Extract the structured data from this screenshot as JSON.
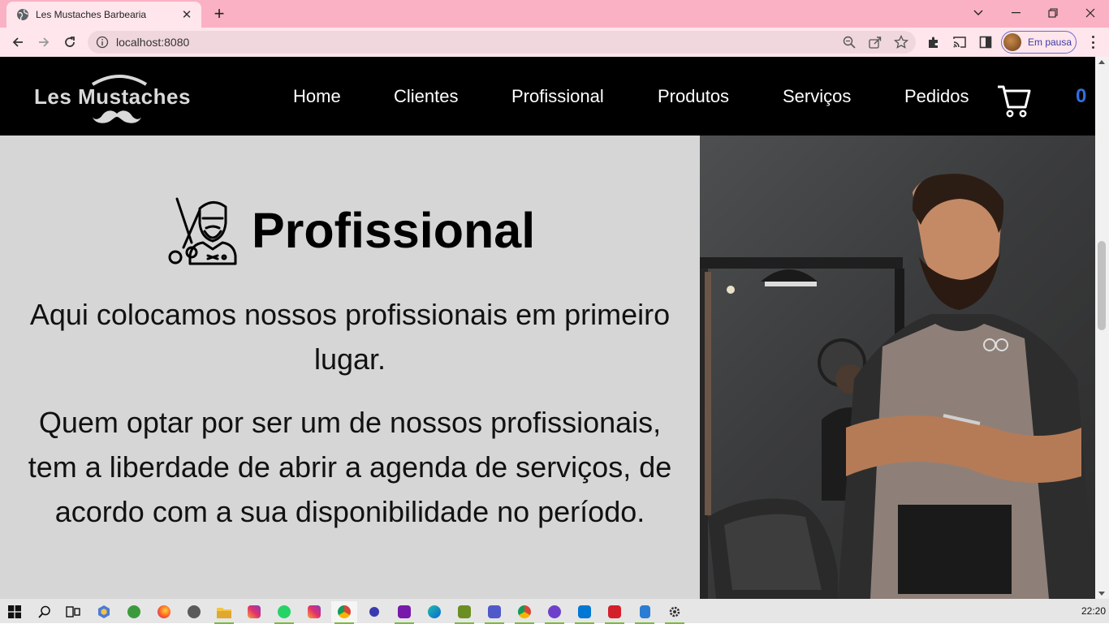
{
  "browser": {
    "tab_title": "Les Mustaches Barbearia",
    "url": "localhost:8080",
    "profile_label": "Em pausa"
  },
  "site": {
    "logo_text": "Les Mustaches",
    "nav": [
      "Home",
      "Clientes",
      "Profissional",
      "Produtos",
      "Serviços",
      "Pedidos"
    ],
    "cart_count": "0"
  },
  "main": {
    "title": "Profissional",
    "paragraph1": "Aqui colocamos nossos profissionais em primeiro lugar.",
    "paragraph2": "Quem optar por ser um de nossos profissionais, tem a liberdade de abrir a agenda de serviços, de acordo com a sua disponibilidade no período."
  },
  "taskbar": {
    "clock": "22:20",
    "apps": [
      "windows-start",
      "search",
      "task-view",
      "app-hexagon",
      "app-green",
      "firefox",
      "whatsapp-web",
      "file-explorer",
      "instagram",
      "whatsapp",
      "instagram-2",
      "chrome",
      "app-moon",
      "onenote",
      "edge",
      "app-lambda",
      "teams",
      "chrome-2",
      "github",
      "vscode",
      "acrobat",
      "app-file",
      "settings"
    ]
  },
  "colors": {
    "tab_bar": "#f9b1c3",
    "toolbar": "#ffe6ec",
    "nav_background": "#000000",
    "page_background": "#d6d6d6",
    "cart_count": "#2f6fe0"
  }
}
